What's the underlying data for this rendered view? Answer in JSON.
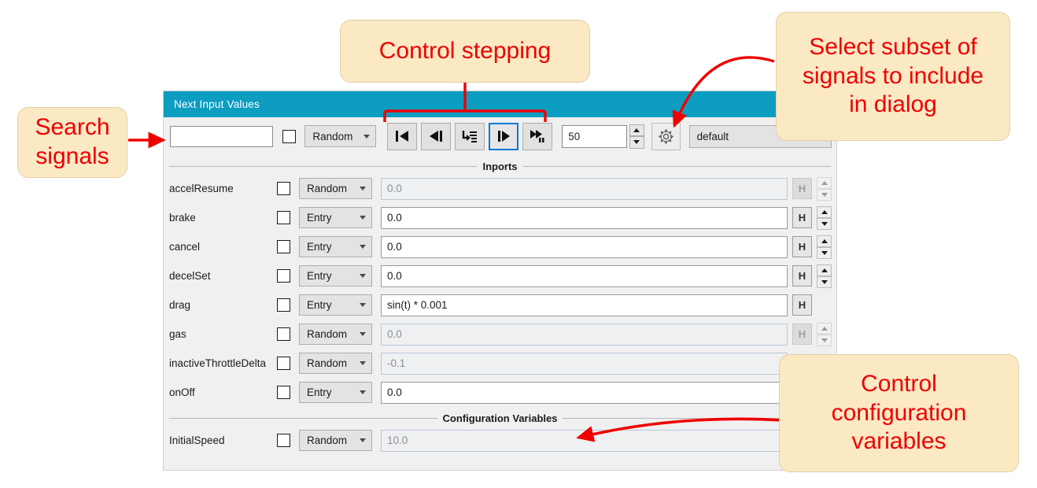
{
  "dialog": {
    "title": "Next Input Values",
    "toolbar": {
      "search_placeholder": "",
      "search_value": "",
      "type_dropdown": "Random",
      "buttons": [
        {
          "name": "step-to-start",
          "tooltip": "Step to start",
          "selected": false
        },
        {
          "name": "step-back",
          "tooltip": "Step back",
          "selected": false
        },
        {
          "name": "step-into",
          "tooltip": "Step into",
          "selected": false
        },
        {
          "name": "step-forward",
          "tooltip": "Step forward",
          "selected": true
        },
        {
          "name": "run-to-pause",
          "tooltip": "Run to pause",
          "selected": false
        }
      ],
      "step_count": "50",
      "gear_label": "",
      "scenario_dropdown": "default"
    },
    "sections": [
      {
        "label": "Inports"
      },
      {
        "label": "Configuration Variables"
      }
    ],
    "inports": [
      {
        "name": "accelResume",
        "mode": "Random",
        "value": "0.0",
        "h": "H",
        "h_enabled": false,
        "spinner": true
      },
      {
        "name": "brake",
        "mode": "Entry",
        "value": "0.0",
        "h": "H",
        "h_enabled": true,
        "spinner": true
      },
      {
        "name": "cancel",
        "mode": "Entry",
        "value": "0.0",
        "h": "H",
        "h_enabled": true,
        "spinner": true
      },
      {
        "name": "decelSet",
        "mode": "Entry",
        "value": "0.0",
        "h": "H",
        "h_enabled": true,
        "spinner": true
      },
      {
        "name": "drag",
        "mode": "Entry",
        "value": "sin(t) * 0.001",
        "h": "H",
        "h_enabled": true,
        "spinner": false
      },
      {
        "name": "gas",
        "mode": "Random",
        "value": "0.0",
        "h": "H",
        "h_enabled": false,
        "spinner": true
      },
      {
        "name": "inactiveThrottleDelta",
        "mode": "Random",
        "value": "-0.1",
        "h": "",
        "h_enabled": false,
        "spinner": false
      },
      {
        "name": "onOff",
        "mode": "Entry",
        "value": "0.0",
        "h": "",
        "h_enabled": true,
        "spinner": false
      }
    ],
    "config_variables": [
      {
        "name": "InitialSpeed",
        "mode": "Random",
        "value": "10.0",
        "h": "",
        "h_enabled": false,
        "spinner": false
      }
    ],
    "checkbox_checked": false
  },
  "annotations": [
    {
      "id": "search",
      "text": "Search\nsignals"
    },
    {
      "id": "step",
      "text": "Control stepping"
    },
    {
      "id": "subset",
      "text": "Select subset of signals to include in dialog"
    },
    {
      "id": "config",
      "text": "Control configuration variables"
    }
  ],
  "annotation_lines": {
    "search": "Search",
    "search2": "signals",
    "step": "Control stepping",
    "subset1": "Select subset of",
    "subset2": "signals to include",
    "subset3": "in dialog",
    "config1": "Control",
    "config2": "configuration",
    "config3": "variables"
  },
  "colors": {
    "titlebar": "#0c9dc0",
    "annotation_text": "#ee0000",
    "annotation_fill": "#fbe9c4",
    "selection": "#0078d7",
    "panel_bg": "#f0f0f0"
  }
}
